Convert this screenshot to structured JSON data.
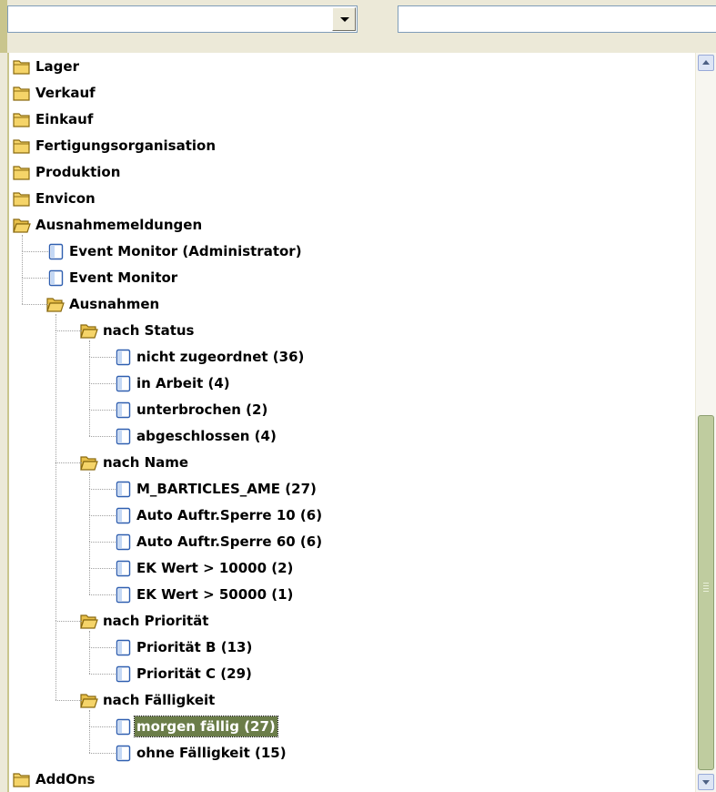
{
  "toolbar": {
    "combo_value": "",
    "text_value": ""
  },
  "tree": {
    "nodes": [
      {
        "label": "Lager",
        "level": 0,
        "icon": "folder-closed-icon"
      },
      {
        "label": "Verkauf",
        "level": 0,
        "icon": "folder-closed-icon"
      },
      {
        "label": "Einkauf",
        "level": 0,
        "icon": "folder-closed-icon"
      },
      {
        "label": "Fertigungsorganisation",
        "level": 0,
        "icon": "folder-closed-icon"
      },
      {
        "label": "Produktion",
        "level": 0,
        "icon": "folder-closed-icon"
      },
      {
        "label": "Envicon",
        "level": 0,
        "icon": "folder-closed-icon"
      },
      {
        "label": "Ausnahmemeldungen",
        "level": 0,
        "icon": "folder-open-icon"
      },
      {
        "label": "Event Monitor (Administrator)",
        "level": 1,
        "icon": "document-icon"
      },
      {
        "label": "Event Monitor",
        "level": 1,
        "icon": "document-icon"
      },
      {
        "label": "Ausnahmen",
        "level": 1,
        "icon": "folder-open-icon"
      },
      {
        "label": "nach Status",
        "level": 2,
        "icon": "folder-open-icon"
      },
      {
        "label": "nicht zugeordnet (36)",
        "level": 3,
        "icon": "document-icon"
      },
      {
        "label": "in Arbeit (4)",
        "level": 3,
        "icon": "document-icon"
      },
      {
        "label": "unterbrochen (2)",
        "level": 3,
        "icon": "document-icon"
      },
      {
        "label": "abgeschlossen (4)",
        "level": 3,
        "icon": "document-icon"
      },
      {
        "label": "nach Name",
        "level": 2,
        "icon": "folder-open-icon"
      },
      {
        "label": "M_BARTICLES_AME (27)",
        "level": 3,
        "icon": "document-icon"
      },
      {
        "label": "Auto Auftr.Sperre 10 (6)",
        "level": 3,
        "icon": "document-icon"
      },
      {
        "label": "Auto Auftr.Sperre 60 (6)",
        "level": 3,
        "icon": "document-icon"
      },
      {
        "label": "EK Wert > 10000 (2)",
        "level": 3,
        "icon": "document-icon"
      },
      {
        "label": "EK Wert > 50000 (1)",
        "level": 3,
        "icon": "document-icon"
      },
      {
        "label": "nach Priorität",
        "level": 2,
        "icon": "folder-open-icon"
      },
      {
        "label": "Priorität B (13)",
        "level": 3,
        "icon": "document-icon"
      },
      {
        "label": "Priorität C (29)",
        "level": 3,
        "icon": "document-icon"
      },
      {
        "label": "nach Fälligkeit",
        "level": 2,
        "icon": "folder-open-icon"
      },
      {
        "label": "morgen fällig (27)",
        "level": 3,
        "icon": "document-icon",
        "selected": true
      },
      {
        "label": "ohne Fälligkeit (15)",
        "level": 3,
        "icon": "document-icon"
      },
      {
        "label": "AddOns",
        "level": 0,
        "icon": "folder-closed-icon"
      }
    ]
  },
  "colors": {
    "selection_bg": "#6b7d49",
    "folder_fill": "#f5d469",
    "scroll_thumb": "#bfcc9f"
  }
}
